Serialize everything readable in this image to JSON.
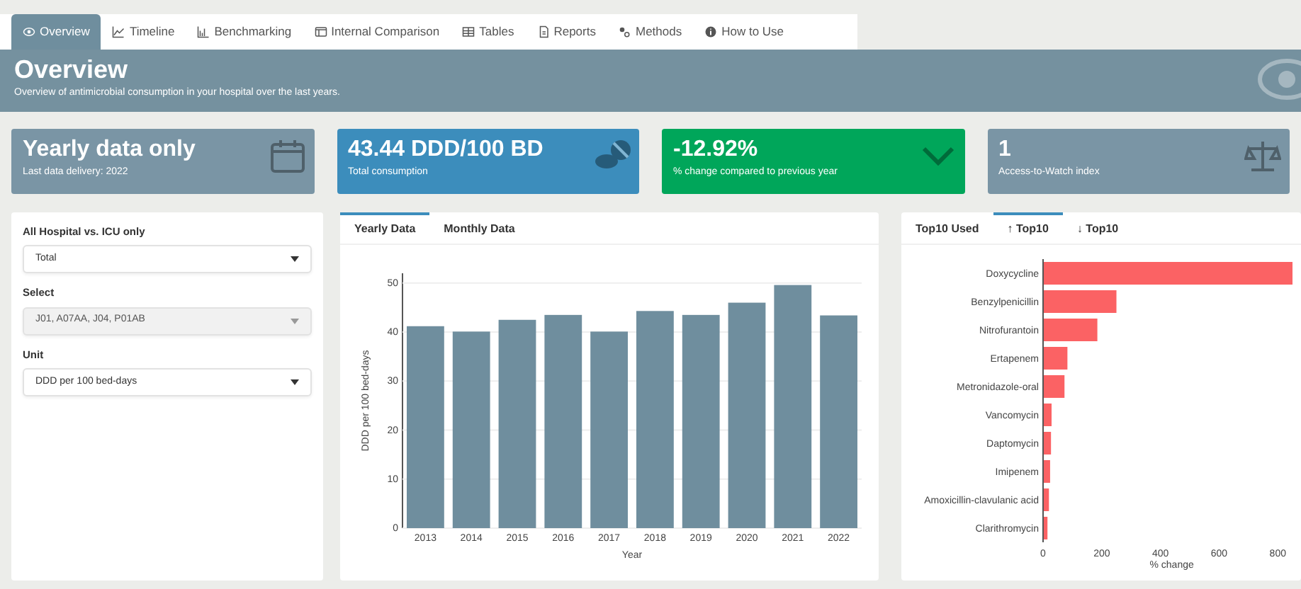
{
  "tabs": [
    {
      "label": "Overview",
      "selected": true
    },
    {
      "label": "Timeline",
      "selected": false
    },
    {
      "label": "Benchmarking",
      "selected": false
    },
    {
      "label": "Internal Comparison",
      "selected": false
    },
    {
      "label": "Tables",
      "selected": false
    },
    {
      "label": "Reports",
      "selected": false
    },
    {
      "label": "Methods",
      "selected": false
    },
    {
      "label": "How to Use",
      "selected": false
    }
  ],
  "header": {
    "title": "Overview",
    "subtitle": "Overview of antimicrobial consumption in your hospital over the last years."
  },
  "value_boxes": [
    {
      "value": "Yearly data only",
      "caption": "Last data delivery: 2022",
      "color": "#7a95a5"
    },
    {
      "value": "43.44 DDD/100 BD",
      "caption": "Total consumption",
      "color": "#3c8dbc"
    },
    {
      "value": "-12.92%",
      "caption": "% change compared to previous year",
      "color": "#00a65a"
    },
    {
      "value": "1",
      "caption": "Access-to-Watch index",
      "color": "#7a95a5"
    }
  ],
  "filters": [
    {
      "label": "All Hospital vs. ICU only",
      "value": "Total",
      "disabled": false
    },
    {
      "label": "Select",
      "value": "J01, A07AA, J04, P01AB",
      "disabled": true
    },
    {
      "label": "Unit",
      "value": "DDD per 100 bed-days",
      "disabled": false
    }
  ],
  "trend_panel": {
    "tabs": [
      {
        "label": "Yearly Data",
        "selected": true
      },
      {
        "label": "Monthly Data",
        "selected": false
      }
    ],
    "chart_data": {
      "type": "bar",
      "orientation": "vertical",
      "grid": true,
      "xlabel": "Year",
      "ylabel": "DDD per 100 bed-days",
      "categories": [
        "2013",
        "2014",
        "2015",
        "2016",
        "2017",
        "2018",
        "2019",
        "2020",
        "2021",
        "2022"
      ],
      "series": [
        {
          "color": "#6f8e9e",
          "values": [
            41.2,
            40.1,
            42.5,
            43.5,
            40.1,
            44.3,
            43.5,
            46.0,
            49.6,
            43.4
          ]
        }
      ],
      "ylim": [
        0,
        52
      ],
      "yticks": [
        0,
        10,
        20,
        30,
        40,
        50
      ]
    }
  },
  "top_panel": {
    "tabs": [
      {
        "label": "Top10 Used",
        "selected": false
      },
      {
        "label": "↑ Top10",
        "selected": true
      },
      {
        "label": "↓ Top10",
        "selected": false
      }
    ],
    "chart_data": {
      "type": "bar",
      "orientation": "horizontal",
      "xlabel": "% change",
      "categories": [
        "Doxycycline",
        "Benzylpenicillin",
        "Nitrofurantoin",
        "Ertapenem",
        "Metronidazole-oral",
        "Vancomycin",
        "Daptomycin",
        "Imipenem",
        "Amoxicillin-clavulanic acid",
        "Clarithromycin"
      ],
      "series": [
        {
          "color": "#fb6264",
          "values": [
            850,
            250,
            185,
            83,
            73,
            29,
            27,
            24,
            20,
            15
          ]
        }
      ],
      "xlim": [
        0,
        850
      ],
      "xticks": [
        0,
        200,
        400,
        600,
        800
      ]
    }
  }
}
